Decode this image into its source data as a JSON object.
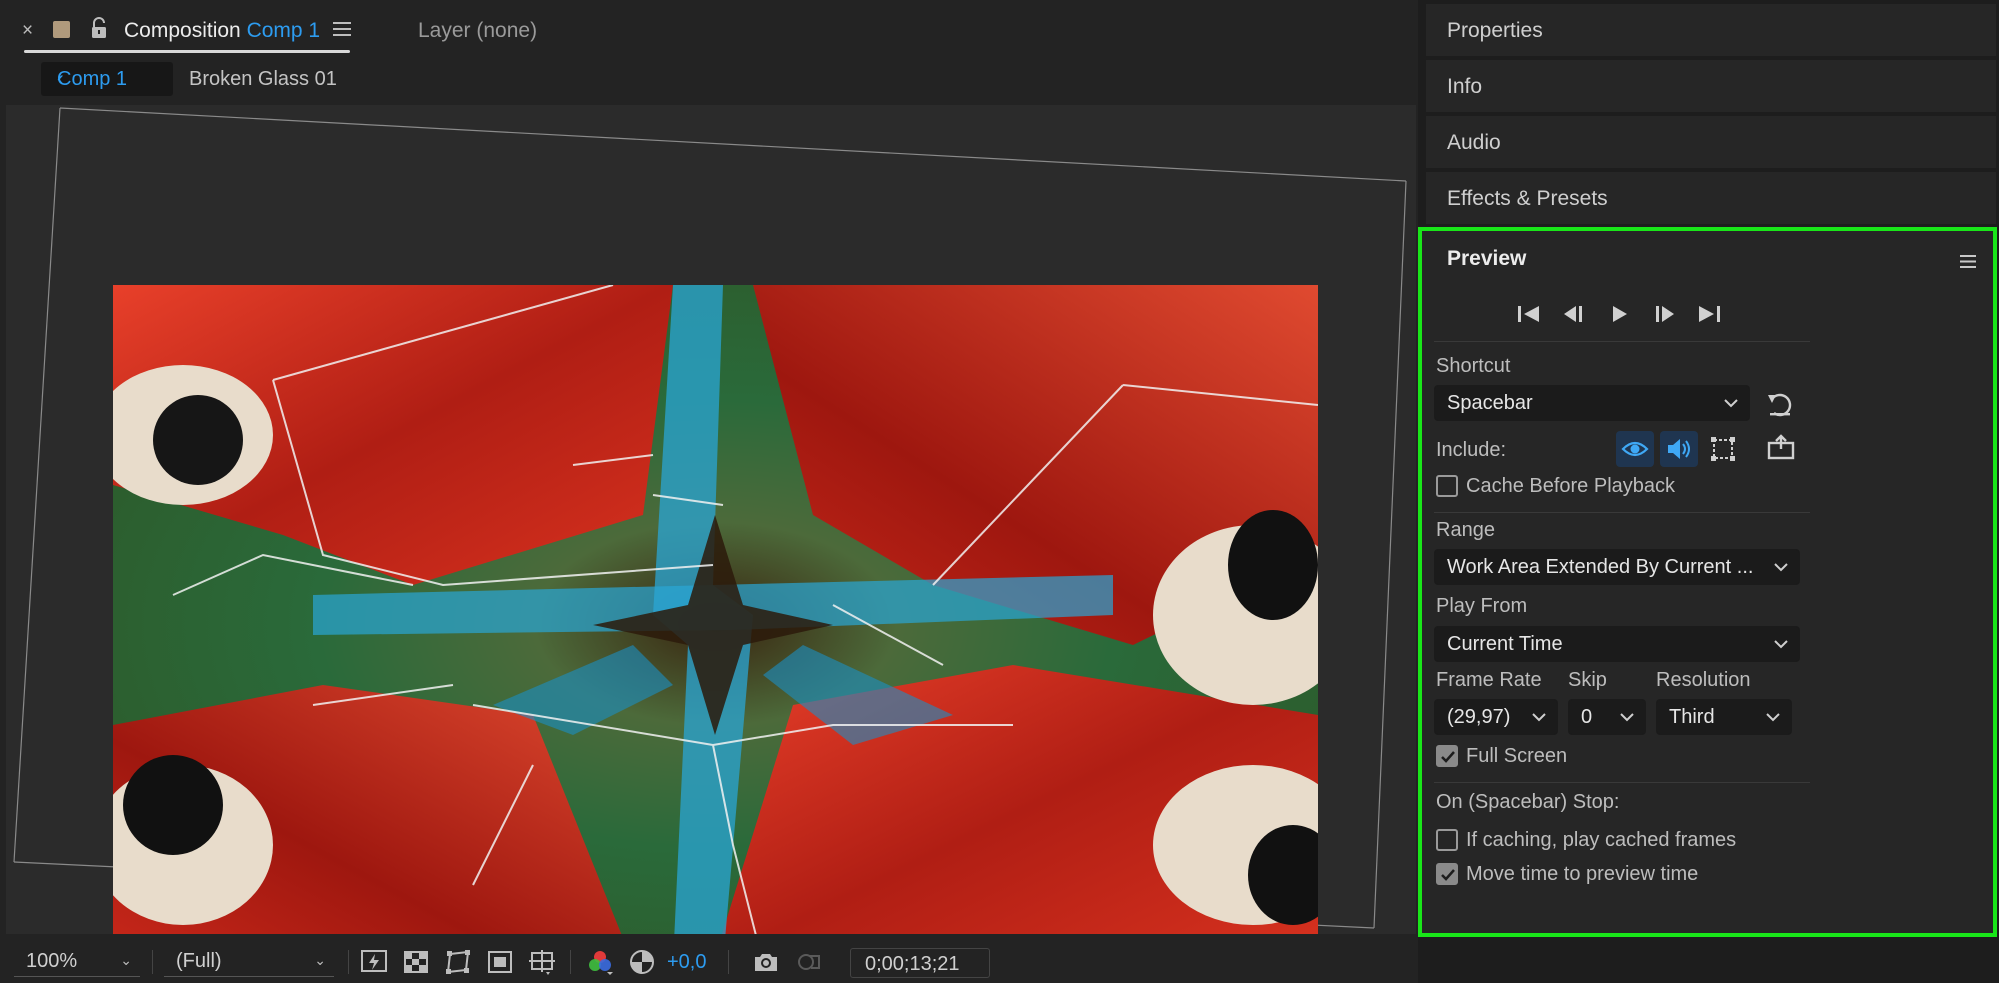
{
  "composition_panel": {
    "tab_prefix": "Composition",
    "tab_comp_name": "Comp 1",
    "layer_tab": "Layer (none)",
    "breadcrumb_active": "Comp 1",
    "breadcrumb_next": "Broken Glass 01"
  },
  "viewer_toolbar": {
    "zoom": "100%",
    "resolution": "(Full)",
    "exposure": "+0,0",
    "timecode": "0;00;13;21"
  },
  "panels": {
    "properties": "Properties",
    "info": "Info",
    "audio": "Audio",
    "effects": "Effects & Presets"
  },
  "preview": {
    "title": "Preview",
    "shortcut_label": "Shortcut",
    "shortcut_value": "Spacebar",
    "include_label": "Include:",
    "cache_before_playback": {
      "label": "Cache Before Playback",
      "checked": false
    },
    "range_label": "Range",
    "range_value": "Work Area Extended By Current ...",
    "play_from_label": "Play From",
    "play_from_value": "Current Time",
    "frame_rate_label": "Frame Rate",
    "frame_rate_value": "(29,97)",
    "skip_label": "Skip",
    "skip_value": "0",
    "resolution_label": "Resolution",
    "resolution_value": "Third",
    "full_screen": {
      "label": "Full Screen",
      "checked": true
    },
    "stop_label": "On (Spacebar) Stop:",
    "if_caching": {
      "label": "If caching, play cached frames",
      "checked": false
    },
    "move_time": {
      "label": "Move time to preview time",
      "checked": true
    }
  },
  "colors": {
    "accent_blue": "#2d9cf0",
    "highlight_green": "#19e619",
    "panel_bg": "#262626"
  }
}
